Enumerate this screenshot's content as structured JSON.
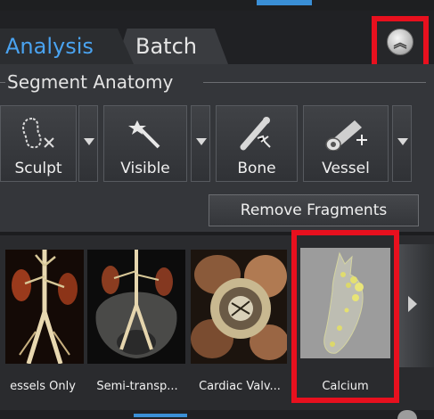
{
  "tabs": [
    {
      "label": "Analysis",
      "active": true
    },
    {
      "label": "Batch",
      "active": false
    }
  ],
  "collapse_icon": "double-chevron-up-icon",
  "segment_group": {
    "title": "Segment Anatomy",
    "tools": [
      {
        "label": "Sculpt",
        "icon": "sculpt-icon"
      },
      {
        "label": "Visible",
        "icon": "magic-wand-icon"
      },
      {
        "label": "Bone",
        "icon": "bone-removal-icon"
      },
      {
        "label": "Vessel",
        "icon": "vessel-add-icon"
      }
    ],
    "remove_fragments": "Remove Fragments"
  },
  "presets": [
    {
      "label": "essels Only"
    },
    {
      "label": "Semi-transp..."
    },
    {
      "label": "Cardiac Valv..."
    },
    {
      "label": "Calcium",
      "selected": true
    }
  ],
  "colors": {
    "accent": "#4aa3f0",
    "highlight": "#e8101e"
  }
}
